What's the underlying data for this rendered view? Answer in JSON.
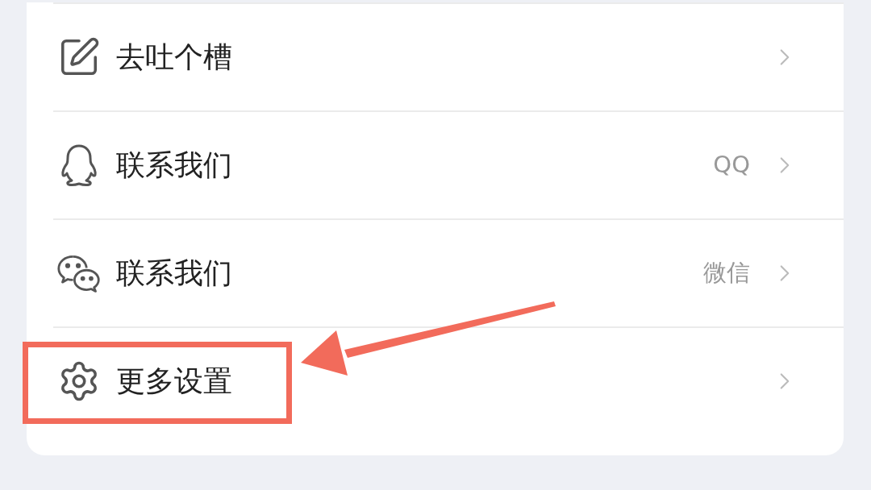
{
  "menu": [
    {
      "label": "去吐个槽",
      "highlighted": false
    },
    {
      "label": "联系我们",
      "value": "QQ",
      "highlighted": false
    },
    {
      "label": "联系我们",
      "value": "微信",
      "highlighted": false
    },
    {
      "label": "更多设置",
      "highlighted": true
    }
  ]
}
